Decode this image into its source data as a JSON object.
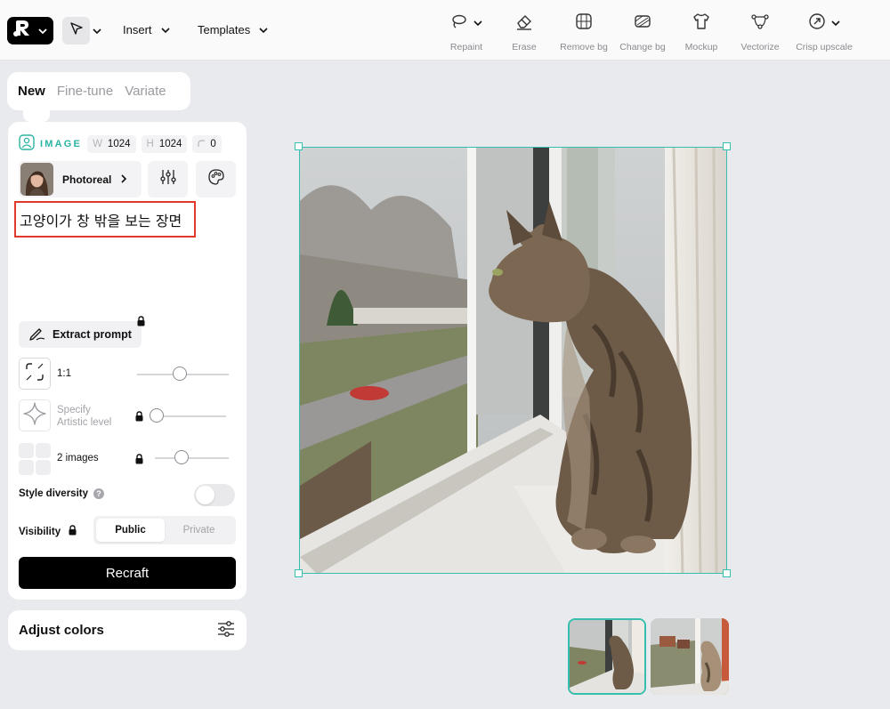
{
  "toolbar": {
    "menus": [
      {
        "label": "Insert"
      },
      {
        "label": "Templates"
      }
    ],
    "tools": [
      {
        "label": "Repaint",
        "icon": "lasso-icon"
      },
      {
        "label": "Erase",
        "icon": "eraser-icon"
      },
      {
        "label": "Remove bg",
        "icon": "remove-bg-icon"
      },
      {
        "label": "Change bg",
        "icon": "change-bg-icon"
      },
      {
        "label": "Mockup",
        "icon": "tshirt-icon"
      },
      {
        "label": "Vectorize",
        "icon": "vector-nodes-icon"
      },
      {
        "label": "Crisp upscale",
        "icon": "upscale-icon"
      }
    ]
  },
  "tabs": [
    {
      "label": "New",
      "active": true
    },
    {
      "label": "Fine-tune",
      "active": false
    },
    {
      "label": "Variate",
      "active": false
    }
  ],
  "panel": {
    "image_label": "IMAGE",
    "width_key": "W",
    "width_value": "1024",
    "height_key": "H",
    "height_value": "1024",
    "seed_value": "0",
    "style_name": "Photoreal",
    "prompt": "고양이가 창 밖을 보는 장면",
    "extract_label": "Extract prompt",
    "aspect_label": "1:1",
    "artistic_label_line1": "Specify",
    "artistic_label_line2": "Artistic level",
    "images_label": "2 images",
    "style_diversity_label": "Style diversity",
    "style_diversity_on": false,
    "visibility_label": "Visibility",
    "visibility_options": [
      "Public",
      "Private"
    ],
    "visibility_selected": "Public",
    "recraft_label": "Recraft"
  },
  "adjust_colors_label": "Adjust colors",
  "colors": {
    "accent": "#35bfae",
    "highlight": "#e0392b"
  }
}
